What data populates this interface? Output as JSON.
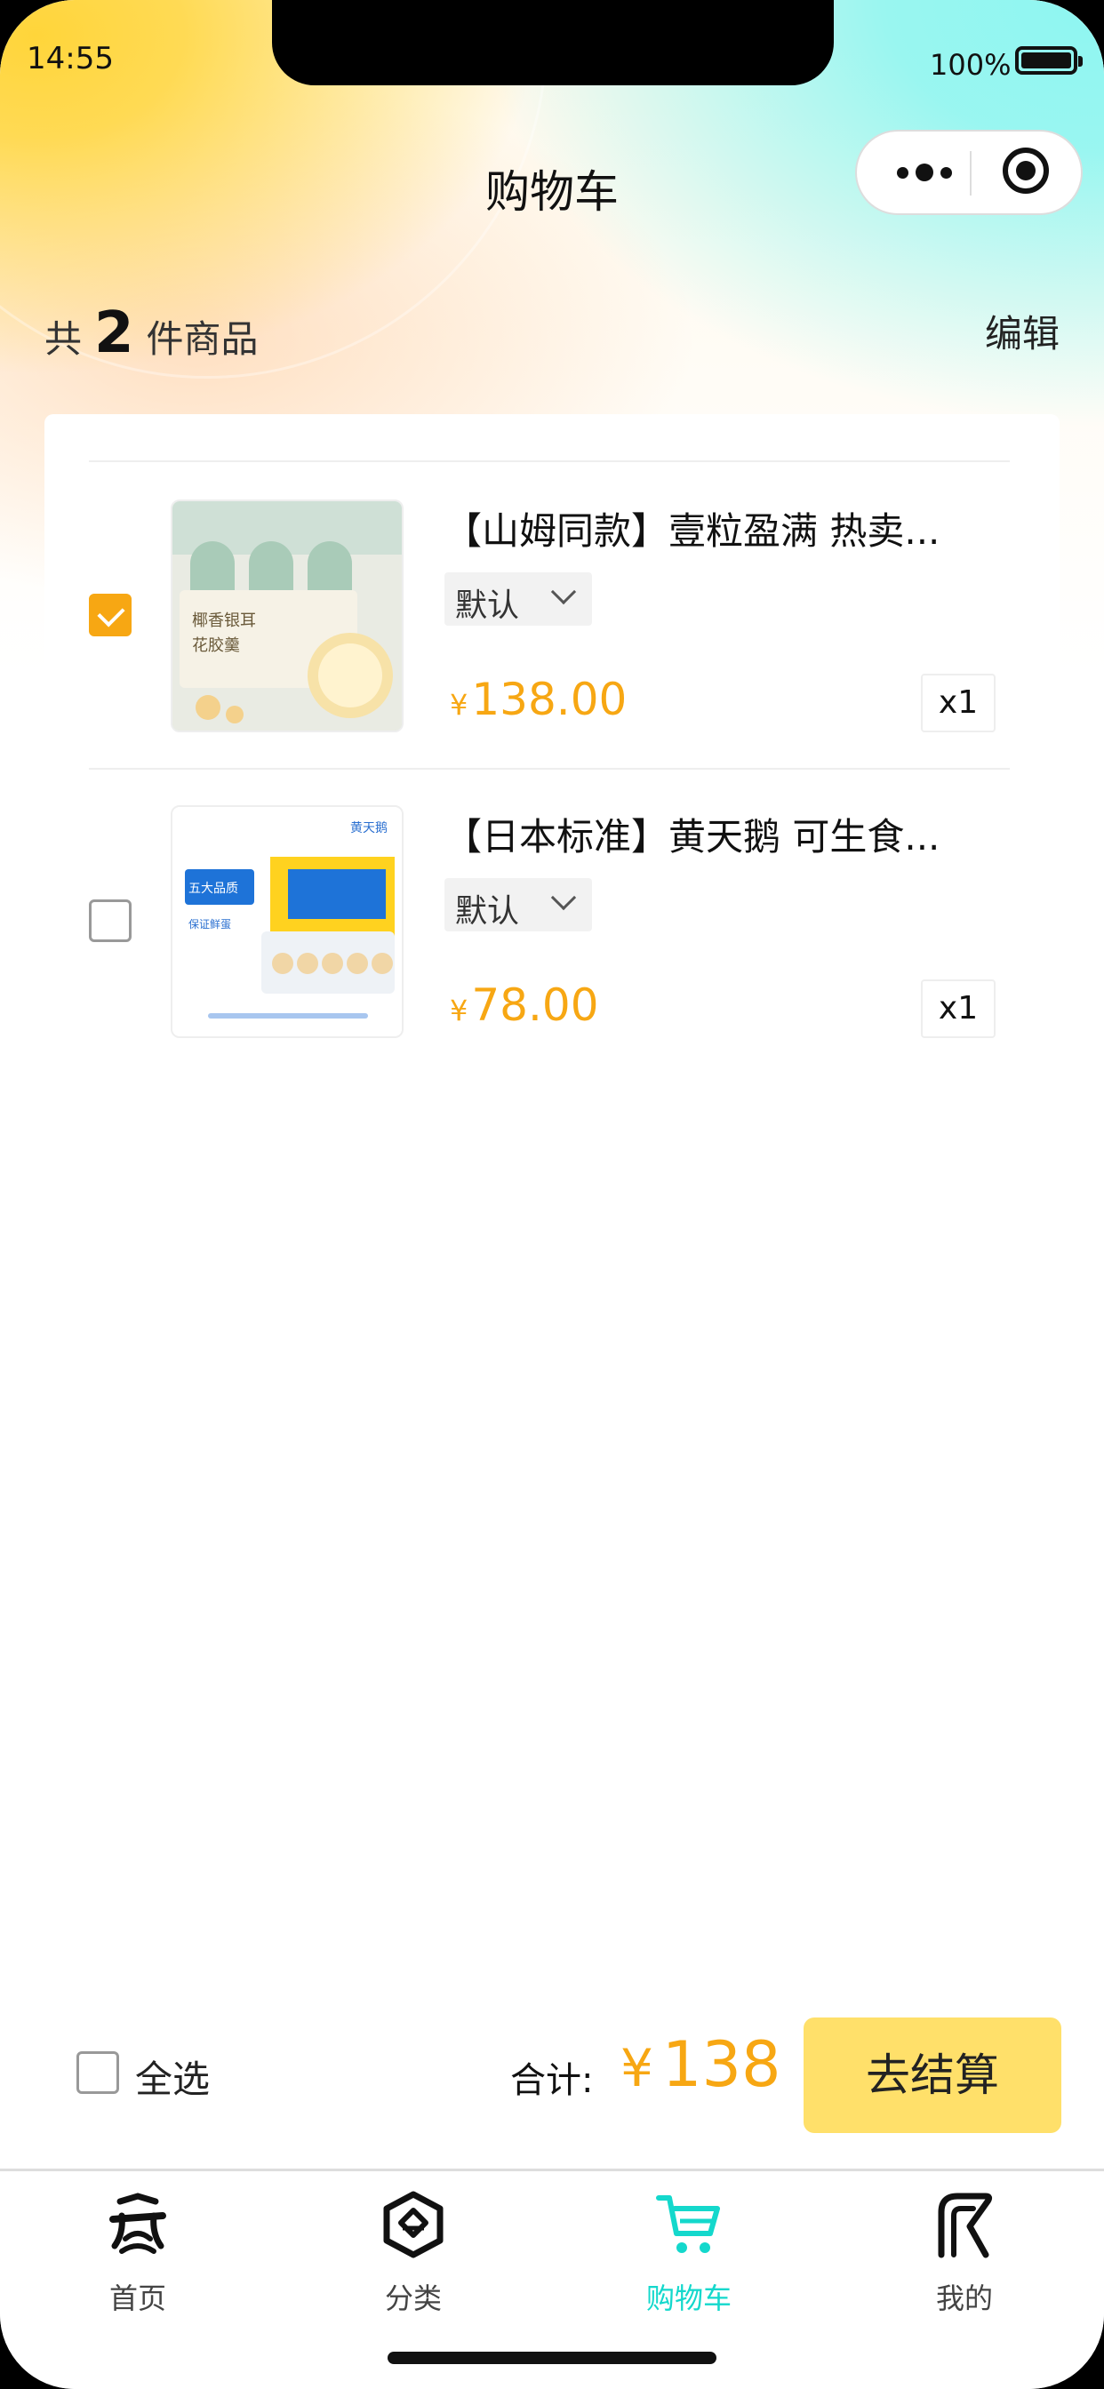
{
  "status_bar": {
    "time": "14:55",
    "battery": "100%"
  },
  "nav": {
    "title": "购物车"
  },
  "summary": {
    "prefix": "共",
    "count": "2",
    "suffix": "件商品",
    "edit": "编辑"
  },
  "items": [
    {
      "title": "【山姆同款】壹粒盈满 热卖...",
      "spec": "默认",
      "currency": "¥",
      "price": "138.00",
      "quantity": "x1",
      "checked": true,
      "image_texts": [
        "椰香银耳",
        "花胶羹"
      ]
    },
    {
      "title": "【日本标准】黄天鹅 可生食...",
      "spec": "默认",
      "currency": "¥",
      "price": "78.00",
      "quantity": "x1",
      "checked": false,
      "image_texts": [
        "黄天鹅",
        "五大品质",
        "保证鲜蛋"
      ]
    }
  ],
  "footer": {
    "select_all": "全选",
    "total_label": "合计:",
    "currency": "¥",
    "total": "138",
    "checkout": "去结算"
  },
  "tabs": [
    {
      "label": "首页",
      "icon": "home-icon",
      "active": false
    },
    {
      "label": "分类",
      "icon": "category-icon",
      "active": false
    },
    {
      "label": "购物车",
      "icon": "cart-icon",
      "active": true
    },
    {
      "label": "我的",
      "icon": "profile-icon",
      "active": false
    }
  ],
  "colors": {
    "accent": "#f7a713",
    "tab_active": "#14d8cc",
    "checkout_bg": "#ffe06a"
  }
}
